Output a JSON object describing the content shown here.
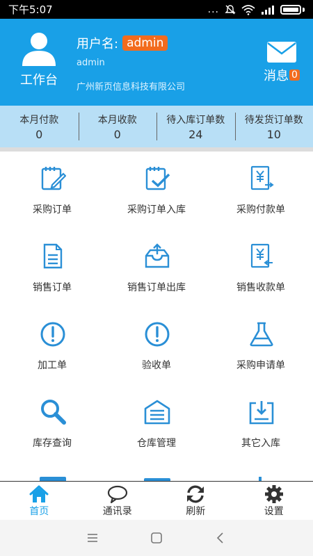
{
  "status_bar": {
    "time": "下午5:07",
    "signal_text": "..."
  },
  "header": {
    "workspace_label": "工作台",
    "username_label": "用户名:",
    "username_badge": "admin",
    "username_sub": "admin",
    "company": "广州新页信息科技有限公司",
    "messages_label": "消息",
    "messages_count": "0"
  },
  "stats": [
    {
      "label": "本月付款",
      "value": "0"
    },
    {
      "label": "本月收款",
      "value": "0"
    },
    {
      "label": "待入库订单数",
      "value": "24"
    },
    {
      "label": "待发货订单数",
      "value": "10"
    }
  ],
  "grid": [
    {
      "label": "采购订单",
      "icon": "purchase-order-icon"
    },
    {
      "label": "采购订单入库",
      "icon": "purchase-inbound-icon"
    },
    {
      "label": "采购付款单",
      "icon": "purchase-payment-icon"
    },
    {
      "label": "销售订单",
      "icon": "sales-order-icon"
    },
    {
      "label": "销售订单出库",
      "icon": "sales-outbound-icon"
    },
    {
      "label": "销售收款单",
      "icon": "sales-receipt-icon"
    },
    {
      "label": "加工单",
      "icon": "processing-order-icon"
    },
    {
      "label": "验收单",
      "icon": "acceptance-icon"
    },
    {
      "label": "采购申请单",
      "icon": "purchase-request-icon"
    },
    {
      "label": "库存查询",
      "icon": "inventory-search-icon"
    },
    {
      "label": "仓库管理",
      "icon": "warehouse-icon"
    },
    {
      "label": "其它入库",
      "icon": "other-inbound-icon"
    }
  ],
  "bottom_nav": [
    {
      "label": "首页",
      "icon": "home-icon",
      "active": true
    },
    {
      "label": "通讯录",
      "icon": "chat-icon",
      "active": false
    },
    {
      "label": "刷新",
      "icon": "refresh-icon",
      "active": false
    },
    {
      "label": "设置",
      "icon": "gear-icon",
      "active": false
    }
  ],
  "colors": {
    "primary": "#19a0e7",
    "accent": "#f26b1d",
    "stats_bg": "#b8dff6"
  }
}
